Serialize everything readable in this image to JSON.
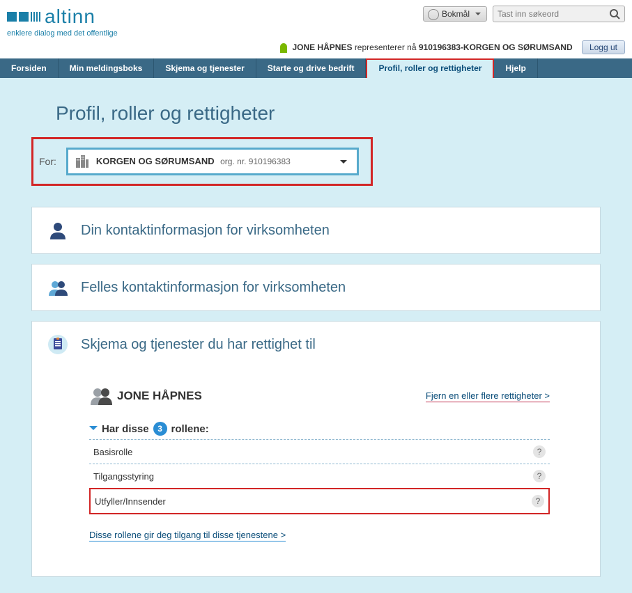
{
  "header": {
    "logo_text": "altinn",
    "tagline": "enklere dialog med det offentlige",
    "language": "Bokmål",
    "search_placeholder": "Tast inn søkeord",
    "user_prefix": "JONE HÅPNES",
    "represents_text": " representerer nå ",
    "org_id": "910196383-KORGEN OG SØRUMSAND",
    "logout": "Logg ut"
  },
  "nav": {
    "items": [
      "Forsiden",
      "Min meldingsboks",
      "Skjema og tjenester",
      "Starte og drive bedrift",
      "Profil, roller og rettigheter",
      "Hjelp"
    ]
  },
  "page": {
    "title": "Profil, roller og rettigheter",
    "for_label": "For:",
    "org_name": "KORGEN OG SØRUMSAND",
    "org_nr_label": " org. nr. 910196383"
  },
  "panels": {
    "contact": "Din kontaktinformasjon for virksomheten",
    "shared": "Felles kontaktinformasjon for virksomheten",
    "rights": "Skjema og tjenester du har rettighet til"
  },
  "rights": {
    "user": "JONE HÅPNES",
    "remove_link": "Fjern en eller flere rettigheter >",
    "roles_prefix": "Har disse",
    "roles_count": "3",
    "roles_suffix": "rollene:",
    "roles": [
      "Basisrolle",
      "Tilgangsstyring",
      "Utfyller/Innsender"
    ],
    "access_link": "Disse rollene gir deg tilgang til disse tjenestene >"
  }
}
